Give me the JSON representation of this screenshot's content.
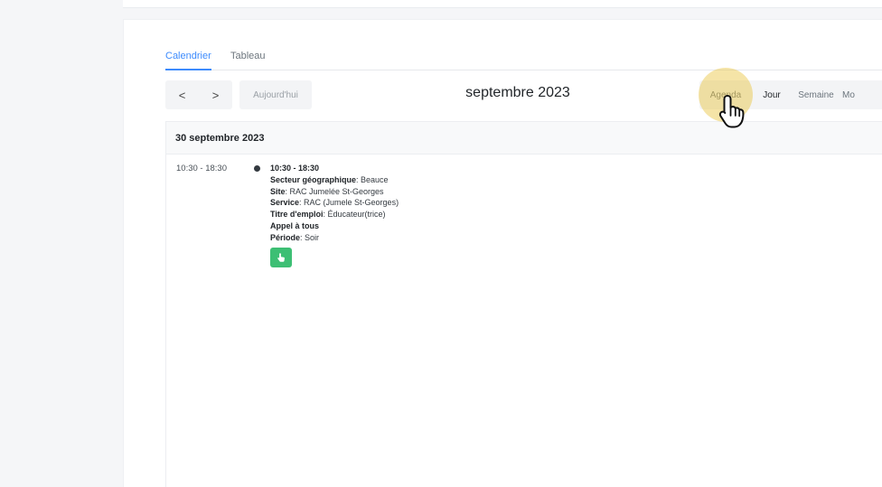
{
  "tabs": {
    "calendar": "Calendrier",
    "table": "Tableau"
  },
  "toolbar": {
    "prev": "<",
    "next": ">",
    "today": "Aujourd'hui",
    "title": "septembre 2023",
    "views": {
      "agenda": "Agenda",
      "day": "Jour",
      "week": "Semaine",
      "month": "Mo"
    }
  },
  "agenda": {
    "date_header": "30 septembre 2023",
    "event": {
      "time": "10:30 - 18:30",
      "title": "10:30 - 18:30",
      "sector_label": "Secteur géographique",
      "sector_value": ": Beauce",
      "site_label": "Site",
      "site_value": ": RAC Jumelée St-Georges",
      "service_label": "Service",
      "service_value": ": RAC (Jumele St-Georges)",
      "job_label": "Titre d'emploi",
      "job_value": ": Éducateur(trice)",
      "call": "Appel à tous",
      "period_label": "Période",
      "period_value": ": Soir"
    }
  },
  "colors": {
    "accent": "#3d8bfd",
    "action": "#3dbf74",
    "highlight": "#e8c43c"
  },
  "icons": {
    "action": "hand-pointer-icon",
    "cursor": "hand-cursor-icon"
  }
}
